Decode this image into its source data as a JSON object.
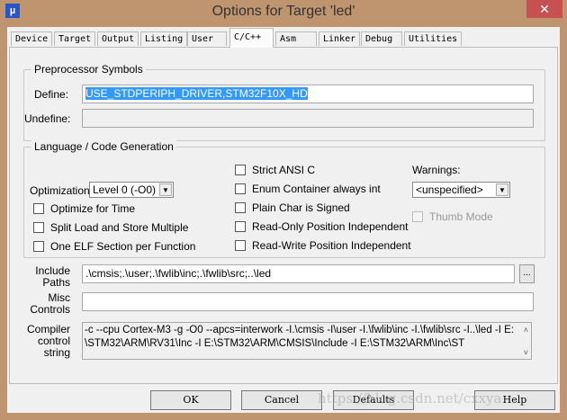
{
  "window": {
    "title": "Options for Target 'led'",
    "close": "✕",
    "icon": "µ"
  },
  "tabs": [
    {
      "label": "Device"
    },
    {
      "label": "Target"
    },
    {
      "label": "Output"
    },
    {
      "label": "Listing"
    },
    {
      "label": "User"
    },
    {
      "label": "C/C++"
    },
    {
      "label": "Asm"
    },
    {
      "label": "Linker"
    },
    {
      "label": "Debug"
    },
    {
      "label": "Utilities"
    }
  ],
  "preprocessor": {
    "title": "Preprocessor Symbols",
    "define_label": "Define:",
    "define_value": "USE_STDPERIPH_DRIVER,STM32F10X_HD",
    "undefine_label": "Undefine:",
    "undefine_value": ""
  },
  "language": {
    "title": "Language / Code Generation",
    "optimization_label": "Optimization:",
    "optimization_value": "Level 0 (-O0)",
    "left_checks": [
      {
        "label": "Optimize for Time",
        "checked": false
      },
      {
        "label": "Split Load and Store Multiple",
        "checked": false
      },
      {
        "label": "One ELF Section per Function",
        "checked": false
      }
    ],
    "mid_checks": [
      {
        "label": "Strict ANSI C",
        "checked": false
      },
      {
        "label": "Enum Container always int",
        "checked": false
      },
      {
        "label": "Plain Char is Signed",
        "checked": false
      },
      {
        "label": "Read-Only Position Independent",
        "checked": false
      },
      {
        "label": "Read-Write Position Independent",
        "checked": false
      }
    ],
    "warnings_label": "Warnings:",
    "warnings_value": "<unspecified>",
    "thumb_mode": "Thumb Mode"
  },
  "include": {
    "label1": "Include",
    "label2": "Paths",
    "value": ".\\cmsis;.\\user;.\\fwlib\\inc;.\\fwlib\\src;..\\led",
    "browse": "..."
  },
  "misc": {
    "label1": "Misc",
    "label2": "Controls",
    "value": ""
  },
  "compiler": {
    "label1": "Compiler",
    "label2": "control",
    "label3": "string",
    "line1": "-c --cpu Cortex-M3 -g -O0 --apcs=interwork -I.\\cmsis -I\\user -I.\\fwlib\\inc -I.\\fwlib\\src -I..\\led -I E:",
    "line2": "\\STM32\\ARM\\RV31\\Inc -I E:\\STM32\\ARM\\CMSIS\\Include -I E:\\STM32\\ARM\\Inc\\ST"
  },
  "buttons": {
    "ok": "OK",
    "cancel": "Cancel",
    "defaults": "Defaults",
    "help": "Help"
  },
  "watermark": "https://blog.csdn.net/cxxya"
}
